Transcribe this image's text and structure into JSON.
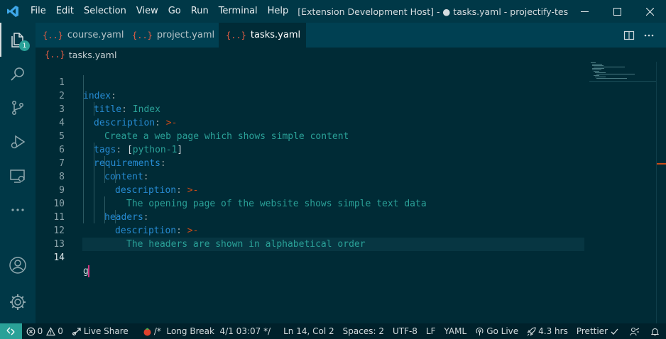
{
  "menu": [
    "File",
    "Edit",
    "Selection",
    "View",
    "Go",
    "Run",
    "Terminal",
    "Help"
  ],
  "window_title": "[Extension Development Host] - ● tasks.yaml - projectify-test - Visual Stu...",
  "activity": {
    "explorer_badge": "1"
  },
  "tabs": [
    {
      "label": "course.yaml",
      "icon": "{..}",
      "active": false
    },
    {
      "label": "project.yaml",
      "icon": "{..}",
      "active": false
    },
    {
      "label": "tasks.yaml",
      "icon": "{..}",
      "active": true,
      "dirty": true
    }
  ],
  "breadcrumb": {
    "icon": "{..}",
    "file": "tasks.yaml"
  },
  "editor": {
    "line_numbers": [
      "1",
      "2",
      "3",
      "4",
      "5",
      "6",
      "7",
      "8",
      "9",
      "10",
      "11",
      "12",
      "13",
      "14"
    ],
    "lines": [
      {
        "key": "index",
        "colon": ":"
      },
      {
        "key": "title",
        "colon": ":",
        "value": " Index"
      },
      {
        "key": "description",
        "colon": ":",
        "op": " >-"
      },
      {
        "text": "Create a web page which shows simple content"
      },
      {
        "key": "tags",
        "colon": ":",
        "bracket_open": " [",
        "value": "python-1",
        "bracket_close": "]"
      },
      {
        "key": "requirements",
        "colon": ":"
      },
      {
        "key": "content",
        "colon": ":"
      },
      {
        "key": "description",
        "colon": ":",
        "op": " >-"
      },
      {
        "text": "The opening page of the website shows simple text data"
      },
      {
        "key": "headers",
        "colon": ":"
      },
      {
        "key": "description",
        "colon": ":",
        "op": " >-"
      },
      {
        "text": "The headers are shown in alphabetical order"
      },
      {
        "text": ""
      },
      {
        "text": "g"
      }
    ]
  },
  "status": {
    "errors": "0",
    "warnings": "0",
    "live_share": "Live Share",
    "pomodoro": "/*  Long Break  4/1 03:07 */",
    "position": "Ln 14, Col 2",
    "spaces": "Spaces: 2",
    "encoding": "UTF-8",
    "eol": "LF",
    "language": "YAML",
    "go_live": "Go Live",
    "time": "4.3 hrs",
    "prettier": "Prettier"
  },
  "colors": {
    "accent": "#2aa198",
    "keyword": "#268bd2",
    "operator": "#cb4b16",
    "background": "#002b36"
  }
}
